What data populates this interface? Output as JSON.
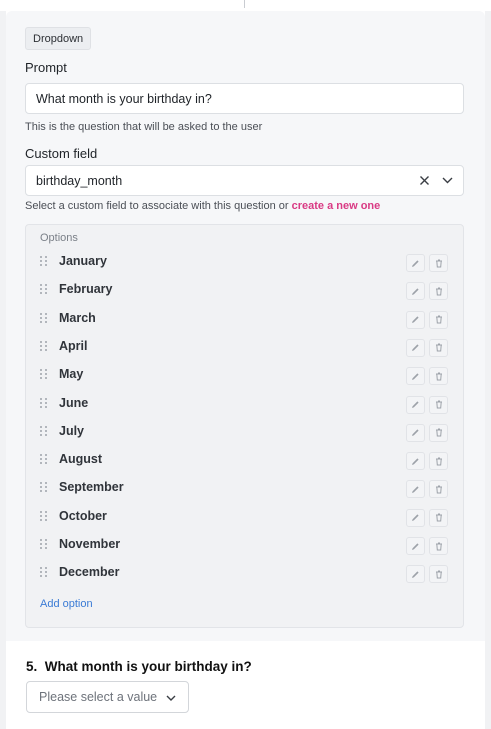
{
  "question": {
    "type_badge": "Dropdown",
    "prompt_label": "Prompt",
    "prompt_value": "What month is your birthday in?",
    "prompt_help": "This is the question that will be asked to the user",
    "custom_field_label": "Custom field",
    "custom_field_value": "birthday_month",
    "custom_field_help": "Select a custom field to associate with this question or",
    "custom_field_link": "create a new one"
  },
  "options": {
    "title": "Options",
    "items": [
      {
        "label": "January"
      },
      {
        "label": "February"
      },
      {
        "label": "March"
      },
      {
        "label": "April"
      },
      {
        "label": "May"
      },
      {
        "label": "June"
      },
      {
        "label": "July"
      },
      {
        "label": "August"
      },
      {
        "label": "September"
      },
      {
        "label": "October"
      },
      {
        "label": "November"
      },
      {
        "label": "December"
      }
    ],
    "add_label": "Add option"
  },
  "preview": {
    "number": "5.",
    "question": "What month is your birthday in?",
    "placeholder": "Please select a value"
  },
  "colors": {
    "link": "#d93a84",
    "add_option": "#3a7bd5",
    "panel": "#f6f7f9"
  }
}
